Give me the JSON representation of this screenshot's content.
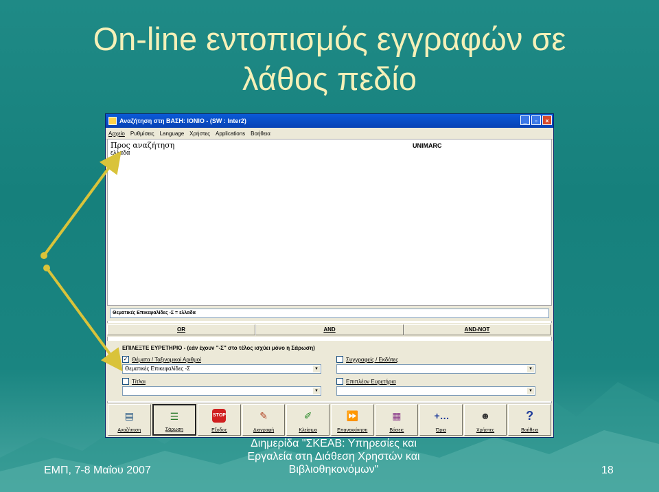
{
  "slide": {
    "title_line1": "On-line εντοπισμός εγγραφών σε",
    "title_line2": "λάθος πεδίο",
    "footer_left": "ΕΜΠ, 7-8 Μαΐου 2007",
    "footer_center_line1": "Διημερίδα \"ΣΚΕΑΒ: Υπηρεσίες και",
    "footer_center_line2": "Εργαλεία στη Διάθεση Χρηστών και",
    "footer_center_line3": "Βιβλιοθηκονόμων\"",
    "page_number": "18"
  },
  "window": {
    "title": "Αναζήτηση στη ΒΑΣΗ: IONIO - (SW : Inter2)",
    "menu": [
      "Αρχείο",
      "Ρυθμίσεις",
      "Language",
      "Χρήστες",
      "Applications",
      "Βοήθεια"
    ],
    "search_label": "Προς αναζήτηση",
    "search_value": "ελλαδα",
    "format": "UNIMARC",
    "query": "Θεματικές Επικεφαλίδες -Σ = ελλαδα",
    "bool": {
      "or": "OR",
      "and": "AND",
      "and_not": "AND-NOT"
    },
    "index_title": "ΕΠΙΛΕΞΤΕ ΕΥΡΕΤΗΡΙΟ - (εάν έχουν \"-Σ\" στο τέλος ισχύει μόνο η Σάρωση)",
    "index_options": {
      "subjects": "Θέματα / Ταξινομικοί Αριθμοί",
      "subjects_value": "Θεματικές Επικεφαλίδες -Σ",
      "authors": "Συγγραφείς / Εκδότες",
      "titles": "Τίτλοι",
      "more": "Επιπλέον Ευρετήρια"
    },
    "toolbar": [
      "Αναζήτηση",
      "Σάρωση",
      "Εξοδος",
      "Διαγραφή",
      "Κλείσιμο",
      "Επανεκκίνηση",
      "Βάσεις",
      "Όρια",
      "Χρήστες",
      "Βοήθεια"
    ]
  },
  "colors": {
    "title": "#f5f0b8",
    "arrow": "#d9c33a",
    "titlebar": "#0a5ad8"
  }
}
